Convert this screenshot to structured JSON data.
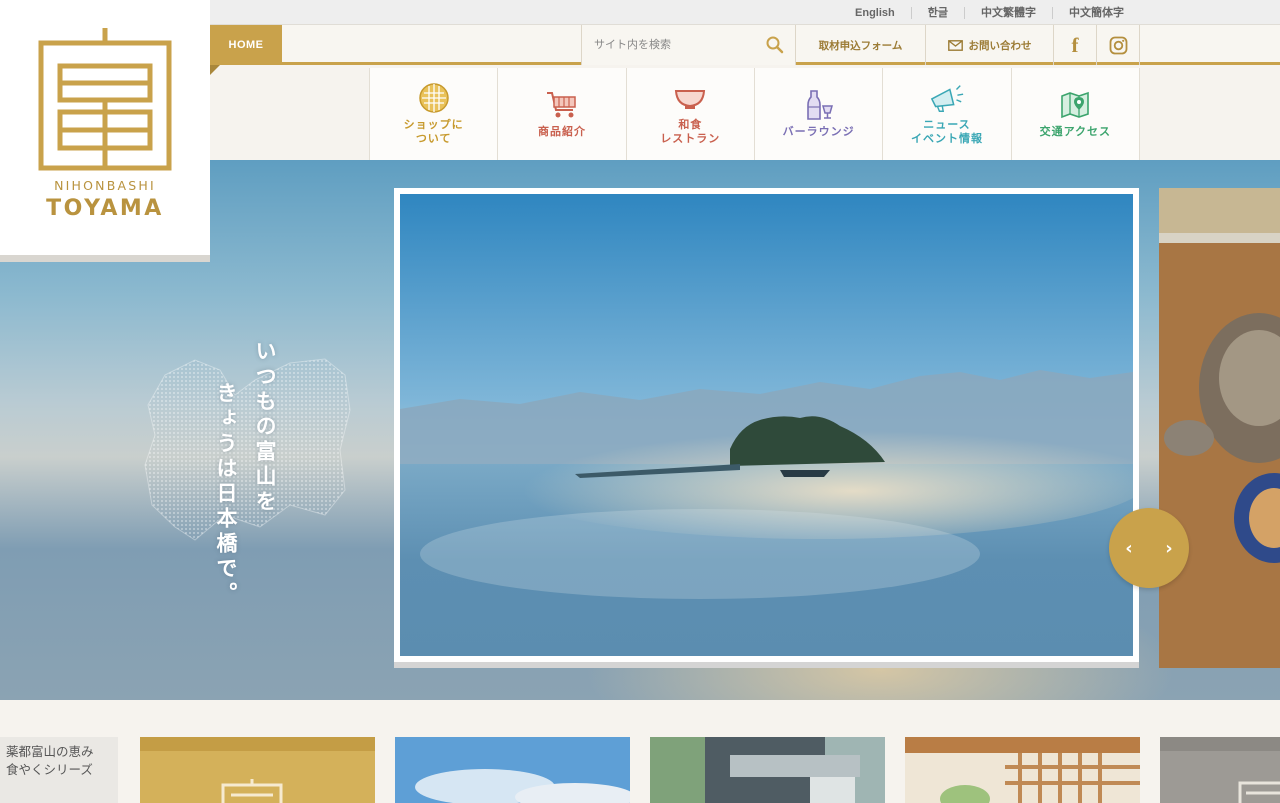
{
  "logo": {
    "sub": "NIHONBASHI",
    "main": "TOYAMA",
    "glyph": "富"
  },
  "languages": [
    "English",
    "한글",
    "中文繁體字",
    "中文簡体字"
  ],
  "utility": {
    "home_label": "HOME",
    "search_placeholder": "サイト内を検索",
    "press_label": "取材申込フォーム",
    "contact_label": "お問い合わせ",
    "facebook_icon": "facebook-icon",
    "instagram_icon": "instagram-icon"
  },
  "nav": [
    {
      "label": "ショップに\nついて",
      "icon": "globe-icon",
      "color": "#c79a2d"
    },
    {
      "label": "商品紹介",
      "icon": "cart-icon",
      "color": "#c9604e"
    },
    {
      "label": "和食\nレストラン",
      "icon": "bowl-icon",
      "color": "#c9604e"
    },
    {
      "label": "バーラウンジ",
      "icon": "bottle-icon",
      "color": "#7a6fb4"
    },
    {
      "label": "ニュース\nイベント情報",
      "icon": "megaphone-icon",
      "color": "#3aa7b5"
    },
    {
      "label": "交通アクセス",
      "icon": "map-icon",
      "color": "#3ca46d"
    }
  ],
  "hero": {
    "tagline_line1": "いつもの富山を",
    "tagline_line2": "きょうは日本橋で。"
  },
  "slider": {
    "prev": "‹",
    "next": "›"
  },
  "banners": {
    "left_text": "薬都富山の恵み\n食やくシリーズ"
  },
  "colors": {
    "gold": "#c9a24b",
    "dark_gold": "#b9933f"
  }
}
